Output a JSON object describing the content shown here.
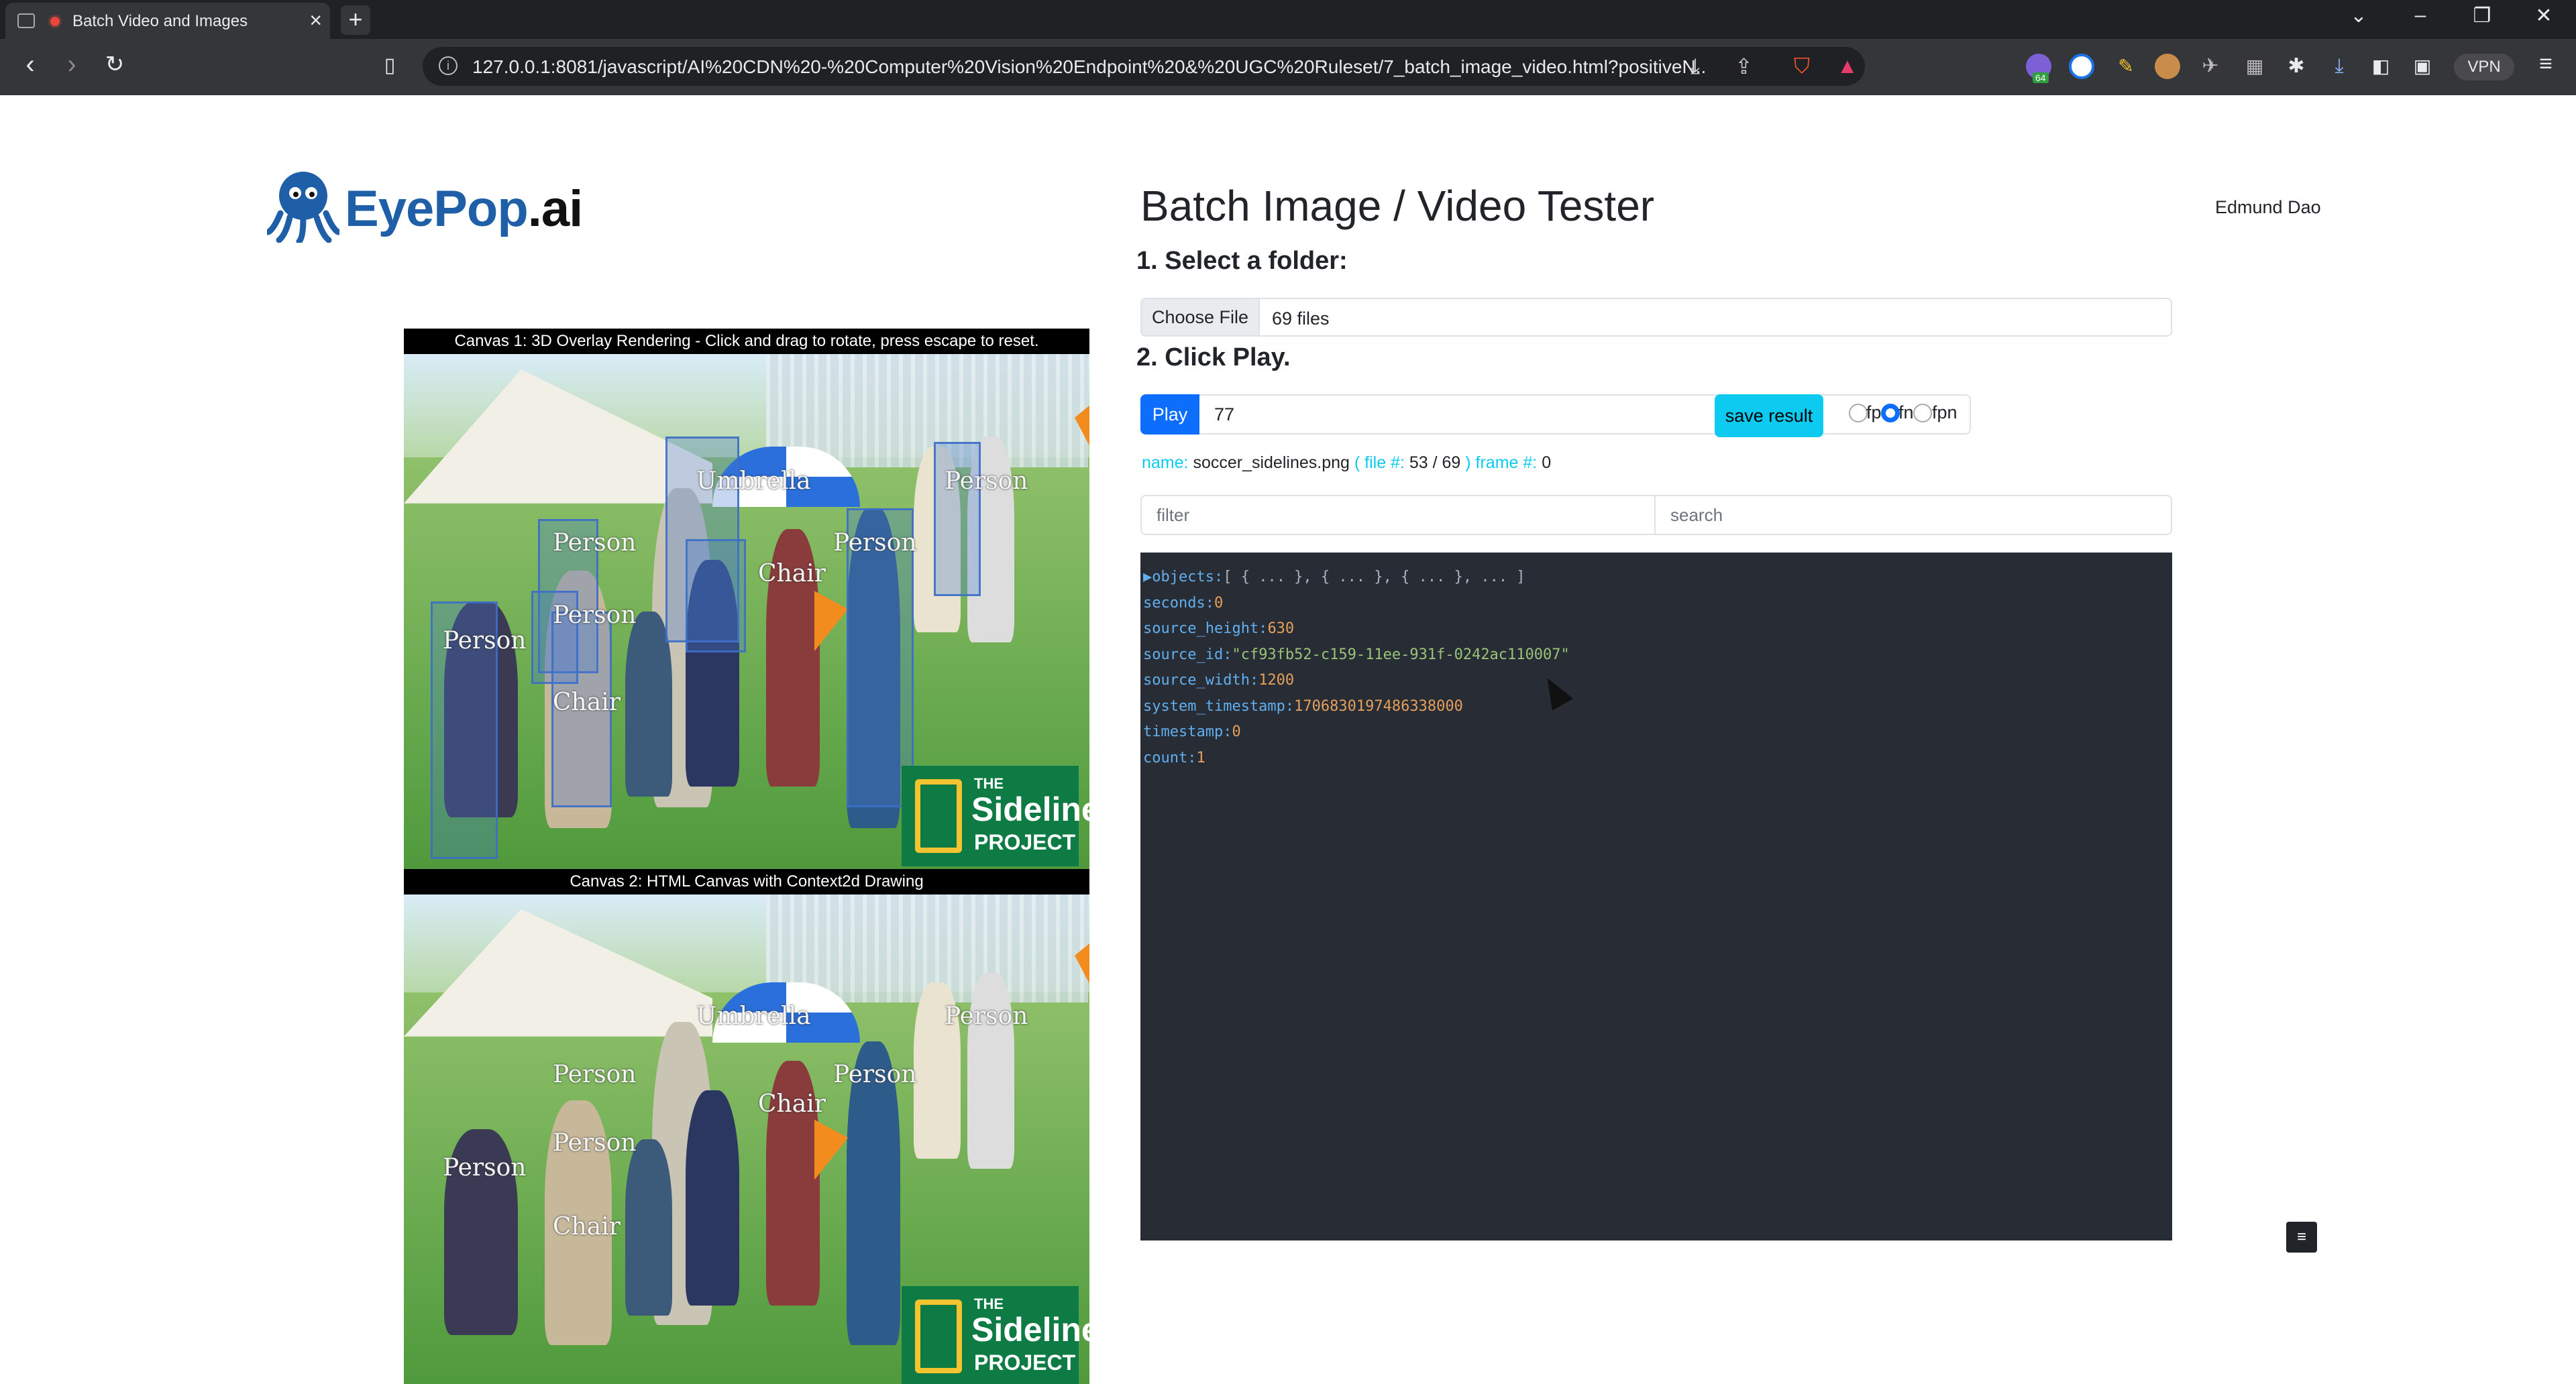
{
  "browser": {
    "tab_title": "Batch Video and Images",
    "url": "127.0.0.1:8081/javascript/AI%20CDN%20-%20Computer%20Vision%20Endpoint%20&%20UGC%20Ruleset/7_batch_image_video.html?positiveN...",
    "vpn_label": "VPN",
    "ext_badge": "64"
  },
  "header": {
    "logo_main": "EyePop",
    "logo_tld": ".ai",
    "title": "Batch Image / Video Tester",
    "user": "Edmund Dao"
  },
  "step1": {
    "label": "1. Select a folder:",
    "choose_file": "Choose File",
    "files": "69 files"
  },
  "step2": {
    "label": "2. Click Play.",
    "play": "Play",
    "input_value": "77",
    "save": "save result",
    "radios": [
      "fp",
      "fn",
      "fpn"
    ],
    "selected_radio": "fn"
  },
  "status": {
    "name_label": "name:",
    "name_value": "soccer_sidelines.png",
    "file_label": "( file #:",
    "file_value": "53 / 69",
    "frame_label": ") frame #:",
    "frame_value": "0"
  },
  "filter": {
    "placeholder": "filter"
  },
  "search": {
    "placeholder": "search"
  },
  "json_view": {
    "rows": [
      {
        "key": "objects",
        "value": "[ { ... }, { ... }, { ... }, ... ]",
        "kind": "p",
        "prefix": "▶"
      },
      {
        "key": "seconds",
        "value": "0",
        "kind": "n"
      },
      {
        "key": "source_height",
        "value": "630",
        "kind": "n"
      },
      {
        "key": "source_id",
        "value": "\"cf93fb52-c159-11ee-931f-0242ac110007\"",
        "kind": "s"
      },
      {
        "key": "source_width",
        "value": "1200",
        "kind": "n"
      },
      {
        "key": "system_timestamp",
        "value": "1706830197486338000",
        "kind": "n"
      },
      {
        "key": "timestamp",
        "value": "0",
        "kind": "n"
      },
      {
        "key": "count",
        "value": "1",
        "kind": "n"
      }
    ]
  },
  "canvas1": {
    "heading": "Canvas 1: 3D Overlay Rendering - Click and drag to rotate, press escape to reset.",
    "labels": [
      "Umbrella",
      "Person",
      "Person",
      "Chair",
      "Person",
      "Person",
      "Person",
      "Chair"
    ]
  },
  "canvas2": {
    "heading": "Canvas 2: HTML Canvas with Context2d Drawing",
    "labels": [
      "Umbrella",
      "Person",
      "Person",
      "Chair",
      "Person",
      "Person",
      "Person",
      "Chair"
    ]
  },
  "sideline_logo": {
    "top": "THE",
    "mid": "Sideline",
    "bot": "PROJECT"
  },
  "menu_icon": "≡"
}
